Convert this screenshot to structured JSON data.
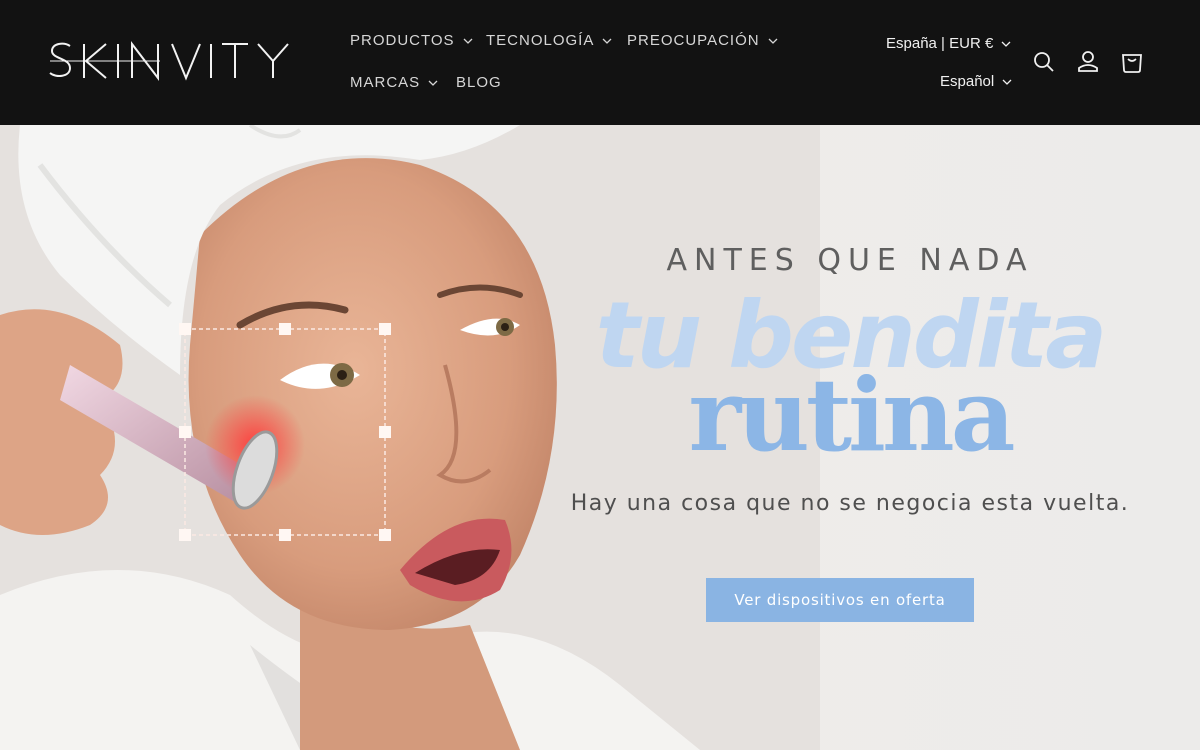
{
  "header": {
    "logo_text": "SKINVITY",
    "nav": [
      {
        "label": "PRODUCTOS",
        "has_dropdown": true
      },
      {
        "label": "TECNOLOGÍA",
        "has_dropdown": true
      },
      {
        "label": "PREOCUPACIÓN",
        "has_dropdown": true
      },
      {
        "label": "MARCAS",
        "has_dropdown": true
      },
      {
        "label": "BLOG",
        "has_dropdown": false
      }
    ],
    "country_currency": "España | EUR €",
    "language": "Español",
    "icons": [
      "search-icon",
      "account-icon",
      "cart-icon"
    ]
  },
  "hero": {
    "eyebrow": "ANTES QUE NADA",
    "headline_script": "tu bendita",
    "headline_big": "rutina",
    "subtitle": "Hay una cosa que no se negocia esta vuelta.",
    "cta_label": "Ver dispositivos en oferta",
    "image": "woman-using-red-light-device-photo"
  },
  "colors": {
    "header_bg": "#121212",
    "accent_light": "#bfd6f1",
    "accent": "#8cb6e6",
    "cta_bg": "#8ab4e3"
  }
}
